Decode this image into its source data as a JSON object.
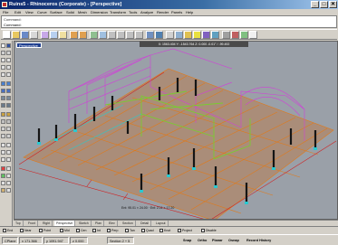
{
  "window": {
    "title": "Ruins5 - Rhinoceros (Corporate) - [Perspective]",
    "controls": {
      "minimize": "_",
      "maximize": "□",
      "close": "✕"
    }
  },
  "menu": [
    "File",
    "Edit",
    "View",
    "Curve",
    "Surface",
    "Solid",
    "Mesh",
    "Dimension",
    "Transform",
    "Tools",
    "Analyze",
    "Render",
    "Panels",
    "Help"
  ],
  "command": {
    "history": "Command: ",
    "prompt": "Command:"
  },
  "viewport": {
    "title": "Perspective",
    "coords_bar": "X: 1563.404   Y: -1543.764   Z: 0.000   -0.01° / -99.492",
    "dims_label": "Ent: 95.01 × 24.00   ·   Ent: 2.11 × 17.20"
  },
  "viewport_tabs": [
    "Top",
    "Front",
    "Right",
    "Perspective",
    "Sketch",
    "Plan",
    "Elev",
    "Section",
    "Detail",
    "Layout"
  ],
  "osnap": {
    "items": [
      "End",
      "Near",
      "Point",
      "Mid",
      "Cen",
      "Int",
      "Perp",
      "Tan",
      "Quad",
      "Knot",
      "Project",
      "Disable"
    ]
  },
  "status": {
    "cplane": "CPlane",
    "x": "x 171.366",
    "y": "y 1091.947",
    "z": "z 0.000",
    "layer": "Section 2 + 5",
    "snap": "Snap",
    "ortho": "Ortho",
    "planar": "Planar",
    "osnap": "Osnap",
    "record": "Record History"
  },
  "colors": {
    "titlebar_start": "#0a246a",
    "viewport_bg": "#9aa0a8",
    "deck_orange": "#e07a1a",
    "railing_magenta": "#d040d8",
    "beam_green": "#7acc30",
    "detail_red": "#d02020",
    "column_cyan": "#2ac8d0",
    "pillar_black": "#151515"
  }
}
